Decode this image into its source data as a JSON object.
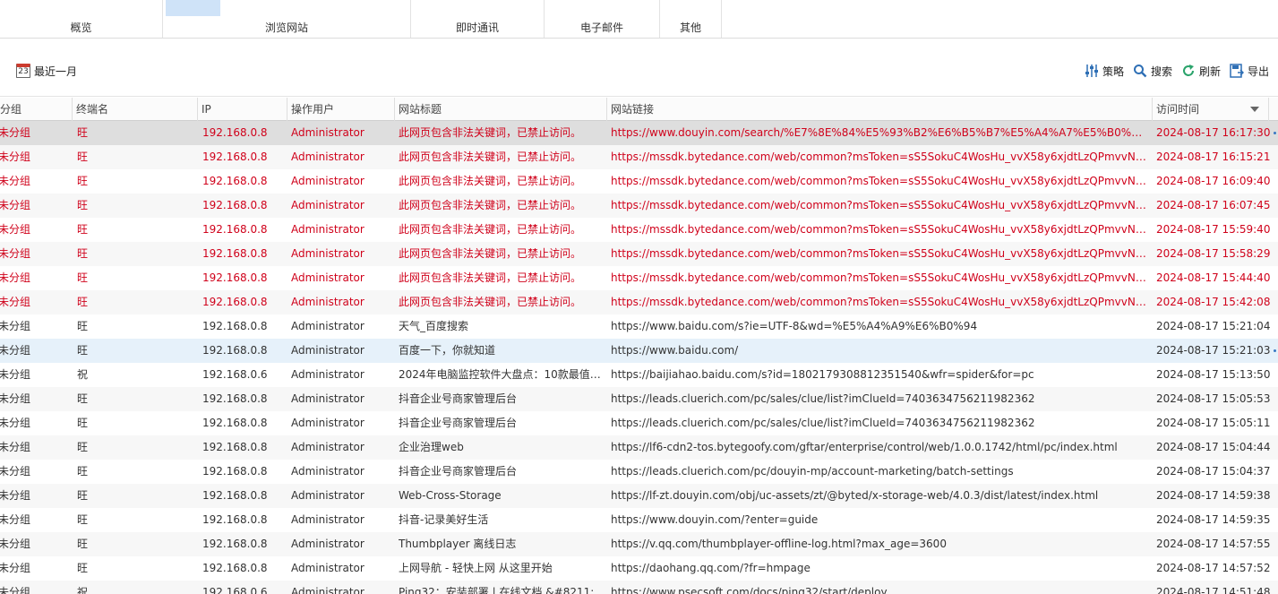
{
  "tabs": [
    {
      "label": "概览"
    },
    {
      "label": "浏览网站"
    },
    {
      "label": "即时通讯"
    },
    {
      "label": "电子邮件"
    },
    {
      "label": "其他"
    }
  ],
  "toolbar": {
    "calendar_icon_text": "23",
    "range_label": "最近一月",
    "policy_label": "策略",
    "search_label": "搜索",
    "refresh_label": "刷新",
    "export_label": "导出"
  },
  "columns": {
    "group": "分组",
    "terminal": "终端名",
    "ip": "IP",
    "user": "操作用户",
    "title": "网站标题",
    "url": "网站链接",
    "time": "访问时间"
  },
  "colors": {
    "blocked_text": "#d0021b",
    "selected_row": "#dedede",
    "highlight_row": "#e6f1fa",
    "accent": "#2e7bcf"
  },
  "rows": [
    {
      "group": "未分组",
      "terminal": "旺",
      "ip": "192.168.0.8",
      "user": "Administrator",
      "title": "此网页包含非法关键词，已禁止访问。",
      "url": "https://www.douyin.com/search/%E7%8E%84%E5%93%B2%E6%B5%B7%E5%A4%A7%E5%B0%86%E…",
      "time": "2024-08-17 16:17:30"
    },
    {
      "group": "未分组",
      "terminal": "旺",
      "ip": "192.168.0.8",
      "user": "Administrator",
      "title": "此网页包含非法关键词，已禁止访问。",
      "url": "https://mssdk.bytedance.com/web/common?msToken=sS5SokuC4WosHu_vvX58y6xjdtLzQPmvvNzO…",
      "time": "2024-08-17 16:15:21"
    },
    {
      "group": "未分组",
      "terminal": "旺",
      "ip": "192.168.0.8",
      "user": "Administrator",
      "title": "此网页包含非法关键词，已禁止访问。",
      "url": "https://mssdk.bytedance.com/web/common?msToken=sS5SokuC4WosHu_vvX58y6xjdtLzQPmvvNzO…",
      "time": "2024-08-17 16:09:40"
    },
    {
      "group": "未分组",
      "terminal": "旺",
      "ip": "192.168.0.8",
      "user": "Administrator",
      "title": "此网页包含非法关键词，已禁止访问。",
      "url": "https://mssdk.bytedance.com/web/common?msToken=sS5SokuC4WosHu_vvX58y6xjdtLzQPmvvNzO…",
      "time": "2024-08-17 16:07:45"
    },
    {
      "group": "未分组",
      "terminal": "旺",
      "ip": "192.168.0.8",
      "user": "Administrator",
      "title": "此网页包含非法关键词，已禁止访问。",
      "url": "https://mssdk.bytedance.com/web/common?msToken=sS5SokuC4WosHu_vvX58y6xjdtLzQPmvvNzO…",
      "time": "2024-08-17 15:59:40"
    },
    {
      "group": "未分组",
      "terminal": "旺",
      "ip": "192.168.0.8",
      "user": "Administrator",
      "title": "此网页包含非法关键词，已禁止访问。",
      "url": "https://mssdk.bytedance.com/web/common?msToken=sS5SokuC4WosHu_vvX58y6xjdtLzQPmvvNzO…",
      "time": "2024-08-17 15:58:29"
    },
    {
      "group": "未分组",
      "terminal": "旺",
      "ip": "192.168.0.8",
      "user": "Administrator",
      "title": "此网页包含非法关键词，已禁止访问。",
      "url": "https://mssdk.bytedance.com/web/common?msToken=sS5SokuC4WosHu_vvX58y6xjdtLzQPmvvNzO…",
      "time": "2024-08-17 15:44:40"
    },
    {
      "group": "未分组",
      "terminal": "旺",
      "ip": "192.168.0.8",
      "user": "Administrator",
      "title": "此网页包含非法关键词，已禁止访问。",
      "url": "https://mssdk.bytedance.com/web/common?msToken=sS5SokuC4WosHu_vvX58y6xjdtLzQPmvvNzO…",
      "time": "2024-08-17 15:42:08"
    },
    {
      "group": "未分组",
      "terminal": "旺",
      "ip": "192.168.0.8",
      "user": "Administrator",
      "title": "天气_百度搜索",
      "url": "https://www.baidu.com/s?ie=UTF-8&wd=%E5%A4%A9%E6%B0%94",
      "time": "2024-08-17 15:21:04"
    },
    {
      "group": "未分组",
      "terminal": "旺",
      "ip": "192.168.0.8",
      "user": "Administrator",
      "title": "百度一下，你就知道",
      "url": "https://www.baidu.com/",
      "time": "2024-08-17 15:21:03"
    },
    {
      "group": "未分组",
      "terminal": "祝",
      "ip": "192.168.0.6",
      "user": "Administrator",
      "title": "2024年电脑监控软件大盘点：10款最值…",
      "url": "https://baijiahao.baidu.com/s?id=1802179308812351540&wfr=spider&for=pc",
      "time": "2024-08-17 15:13:50"
    },
    {
      "group": "未分组",
      "terminal": "旺",
      "ip": "192.168.0.8",
      "user": "Administrator",
      "title": "抖音企业号商家管理后台",
      "url": "https://leads.cluerich.com/pc/sales/clue/list?imClueId=7403634756211982362",
      "time": "2024-08-17 15:05:53"
    },
    {
      "group": "未分组",
      "terminal": "旺",
      "ip": "192.168.0.8",
      "user": "Administrator",
      "title": "抖音企业号商家管理后台",
      "url": "https://leads.cluerich.com/pc/sales/clue/list?imClueId=7403634756211982362",
      "time": "2024-08-17 15:05:11"
    },
    {
      "group": "未分组",
      "terminal": "旺",
      "ip": "192.168.0.8",
      "user": "Administrator",
      "title": "企业治理web",
      "url": "https://lf6-cdn2-tos.bytegoofy.com/gftar/enterprise/control/web/1.0.0.1742/html/pc/index.html",
      "time": "2024-08-17 15:04:44"
    },
    {
      "group": "未分组",
      "terminal": "旺",
      "ip": "192.168.0.8",
      "user": "Administrator",
      "title": "抖音企业号商家管理后台",
      "url": "https://leads.cluerich.com/pc/douyin-mp/account-marketing/batch-settings",
      "time": "2024-08-17 15:04:37"
    },
    {
      "group": "未分组",
      "terminal": "旺",
      "ip": "192.168.0.8",
      "user": "Administrator",
      "title": "Web-Cross-Storage",
      "url": "https://lf-zt.douyin.com/obj/uc-assets/zt/@byted/x-storage-web/4.0.3/dist/latest/index.html",
      "time": "2024-08-17 14:59:38"
    },
    {
      "group": "未分组",
      "terminal": "旺",
      "ip": "192.168.0.8",
      "user": "Administrator",
      "title": "抖音-记录美好生活",
      "url": "https://www.douyin.com/?enter=guide",
      "time": "2024-08-17 14:59:35"
    },
    {
      "group": "未分组",
      "terminal": "旺",
      "ip": "192.168.0.8",
      "user": "Administrator",
      "title": "Thumbplayer 离线日志",
      "url": "https://v.qq.com/thumbplayer-offline-log.html?max_age=3600",
      "time": "2024-08-17 14:57:55"
    },
    {
      "group": "未分组",
      "terminal": "旺",
      "ip": "192.168.0.8",
      "user": "Administrator",
      "title": "上网导航 - 轻快上网 从这里开始",
      "url": "https://daohang.qq.com/?fr=hmpage",
      "time": "2024-08-17 14:57:52"
    },
    {
      "group": "未分组",
      "terminal": "祝",
      "ip": "192.168.0.6",
      "user": "Administrator",
      "title": "Ping32：安装部署 | 在线文档 &#8211;",
      "url": "https://www.psecsoft.com/docs/ping32/start/deploy",
      "time": "2024-08-17 14:51:48"
    }
  ]
}
